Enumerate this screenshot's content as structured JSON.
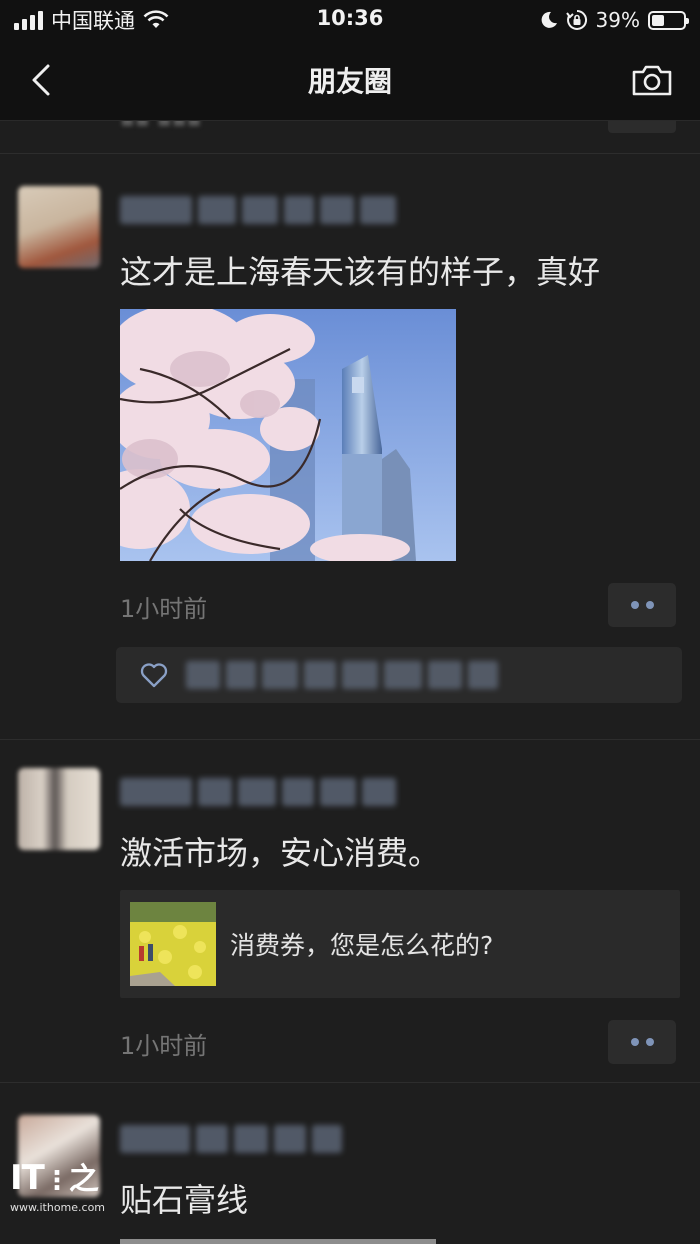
{
  "status_bar": {
    "carrier": "中国联通",
    "time": "10:36",
    "battery_percent": "39%",
    "battery_level": 0.39,
    "icons": [
      "signal-icon",
      "wifi-icon",
      "moon-icon",
      "rotation-lock-icon",
      "battery-icon"
    ]
  },
  "nav": {
    "title": "朋友圈",
    "back_icon": "back-chevron-icon",
    "camera_icon": "camera-icon"
  },
  "posts": [
    {
      "text": "这才是上海春天该有的样子，真好",
      "image": "cherry-blossom-shanghai-skyline-photo",
      "time": "1小时前",
      "likes_icon": "heart-icon"
    },
    {
      "text": "激活市场，安心消费。",
      "link_title": "消费券，您是怎么花的?",
      "link_image": "rapeseed-field-photo",
      "time": "1小时前"
    },
    {
      "text": "贴石膏线"
    }
  ],
  "watermark": {
    "logo": "IT之家",
    "url": "www.ithome.com"
  },
  "colors": {
    "background": "#1e1e1e",
    "bar": "#111111",
    "accent_dots": "#7f94b8",
    "time_text": "#757575"
  }
}
